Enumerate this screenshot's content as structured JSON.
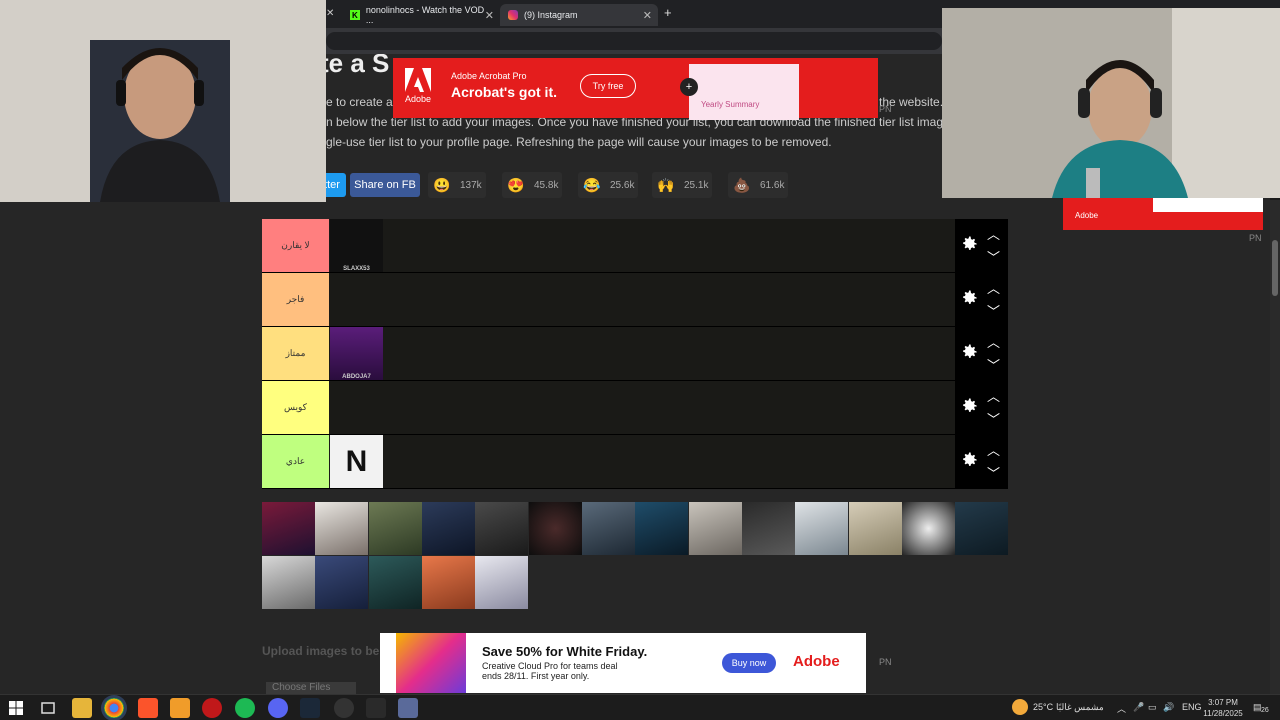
{
  "browser": {
    "tabs": [
      {
        "title": "nonolinhocs - Watch the VOD ...",
        "icon": "kick-icon"
      },
      {
        "title": "(9) Instagram",
        "icon": "instagram-icon"
      }
    ],
    "new_tab": "+",
    "close": "✕"
  },
  "page": {
    "title": "te a S",
    "desc_line1": "e to create a s",
    "desc_line1_end": "the website.",
    "desc_line2": "n below the tier list to add your images. Once you have finished your list, you can download the finished tier list image. It is",
    "desc_line3": "gle-use tier list to your profile page. Refreshing the page will cause your images to be removed.",
    "share_twitter": "tter",
    "share_fb": "Share on FB",
    "reactions": [
      {
        "emoji": "😃",
        "count": "137k",
        "color": "#f4c20d"
      },
      {
        "emoji": "😍",
        "count": "45.8k",
        "color": "#f4c20d"
      },
      {
        "emoji": "😂",
        "count": "25.6k",
        "color": "#f4c20d"
      },
      {
        "emoji": "🙌",
        "count": "25.1k",
        "color": "transparent"
      },
      {
        "emoji": "💩",
        "count": "61.6k",
        "color": "transparent"
      }
    ],
    "upload_label": "Upload images to be ...",
    "choose_files": "Choose Files"
  },
  "tiers": [
    {
      "label": "لا يقارن",
      "color": "#ff7f7f",
      "items": [
        "SLAXX53"
      ]
    },
    {
      "label": "فاجر",
      "color": "#ffbf7f",
      "items": []
    },
    {
      "label": "ممتاز",
      "color": "#ffdf7f",
      "items": [
        "ABDOJA7"
      ]
    },
    {
      "label": "كويس",
      "color": "#ffff7f",
      "items": []
    },
    {
      "label": "عادي",
      "color": "#bfff7f",
      "items": [
        "N"
      ]
    }
  ],
  "pool_count": 19,
  "ads": {
    "top": {
      "brand": "Adobe",
      "product": "Adobe Acrobat Pro",
      "headline": "Acrobat's got it.",
      "cta": "Try free",
      "promo": "Yearly Summary",
      "plus": "+"
    },
    "bottom": {
      "headline": "Save 50% for White Friday.",
      "line1": "Creative Cloud Pro for teams deal",
      "line2": "ends 28/11. First year only.",
      "cta": "Buy now",
      "brand": "Adobe"
    },
    "side": {
      "brand": "Adobe"
    },
    "pn": "PN"
  },
  "taskbar": {
    "weather": "25°C",
    "weather_text": "مشمس غالبًا",
    "lang": "ENG",
    "time": "3:07 PM",
    "date": "11/28/2025",
    "notif": "26"
  }
}
